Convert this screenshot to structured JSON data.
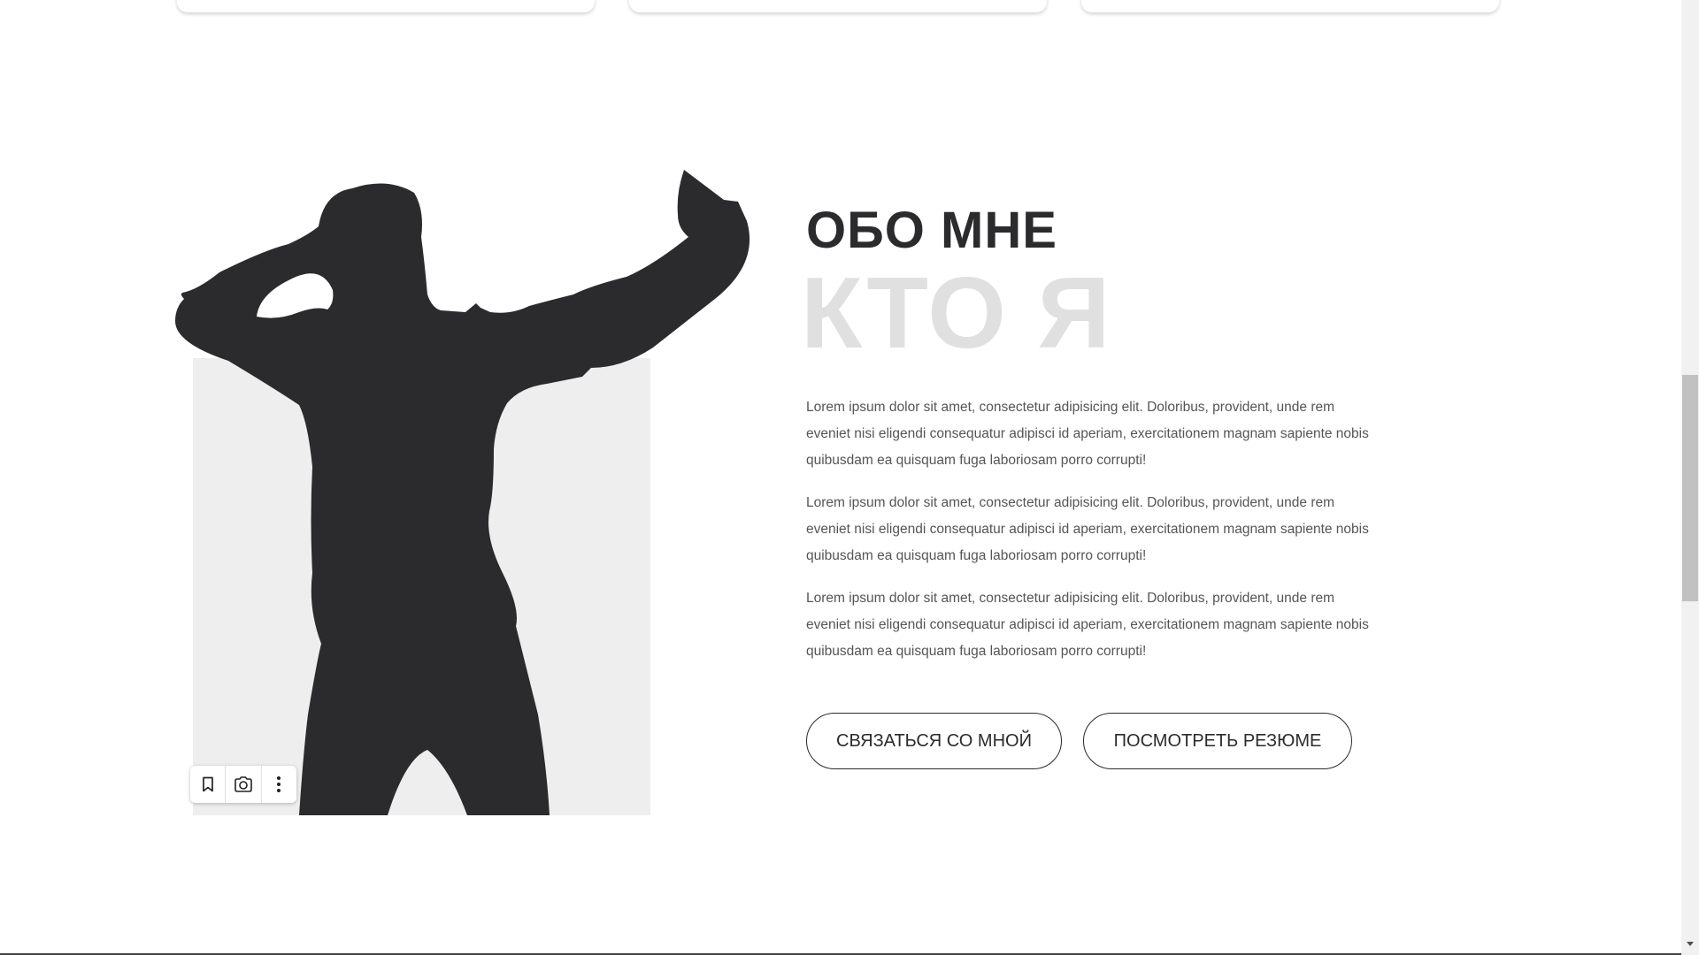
{
  "about": {
    "heading": "ОБО МНЕ",
    "heading_bg": "КТО Я",
    "paragraphs": [
      "Lorem ipsum dolor sit amet, consectetur adipisicing elit. Doloribus, provident, unde rem eveniet nisi eligendi consequatur adipisci id aperiam, exercitationem magnam sapiente nobis quibusdam ea quisquam fuga laboriosam porro corrupti!",
      "Lorem ipsum dolor sit amet, consectetur adipisicing elit. Doloribus, provident, unde rem eveniet nisi eligendi consequatur adipisci id aperiam, exercitationem magnam sapiente nobis quibusdam ea quisquam fuga laboriosam porro corrupti!",
      "Lorem ipsum dolor sit amet, consectetur adipisicing elit. Doloribus, provident, unde rem eveniet nisi eligendi consequatur adipisci id aperiam, exercitationem magnam sapiente nobis quibusdam ea quisquam fuga laboriosam porro corrupti!"
    ],
    "contact_button": "СВЯЗАТЬСЯ СО МНОЙ",
    "resume_button": "ПОСМОТРЕТЬ РЕЗЮМЕ"
  },
  "image_toolbar": {
    "icons": [
      "bookmark-icon",
      "camera-icon",
      "more-vertical-icon"
    ]
  },
  "colors": {
    "text_dark": "#2b2b2d",
    "text_light_heading": "#e0e0e0",
    "photo_bg": "#eeeeee",
    "body_text": "#555555"
  }
}
